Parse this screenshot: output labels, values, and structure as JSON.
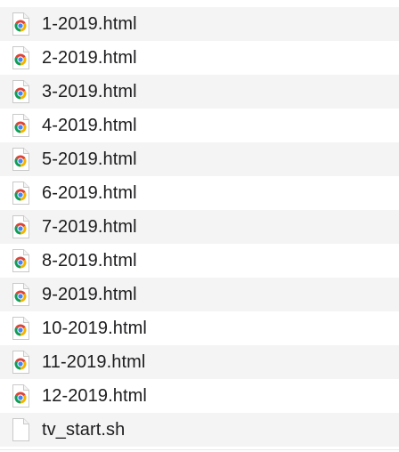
{
  "files": [
    {
      "name": "1-2019.html",
      "icon": "chrome-document-icon"
    },
    {
      "name": "2-2019.html",
      "icon": "chrome-document-icon"
    },
    {
      "name": "3-2019.html",
      "icon": "chrome-document-icon"
    },
    {
      "name": "4-2019.html",
      "icon": "chrome-document-icon"
    },
    {
      "name": "5-2019.html",
      "icon": "chrome-document-icon"
    },
    {
      "name": "6-2019.html",
      "icon": "chrome-document-icon"
    },
    {
      "name": "7-2019.html",
      "icon": "chrome-document-icon"
    },
    {
      "name": "8-2019.html",
      "icon": "chrome-document-icon"
    },
    {
      "name": "9-2019.html",
      "icon": "chrome-document-icon"
    },
    {
      "name": "10-2019.html",
      "icon": "chrome-document-icon"
    },
    {
      "name": "11-2019.html",
      "icon": "chrome-document-icon"
    },
    {
      "name": "12-2019.html",
      "icon": "chrome-document-icon"
    },
    {
      "name": "tv_start.sh",
      "icon": "blank-document-icon"
    }
  ],
  "colors": {
    "stripe": "#f4f4f4",
    "chrome_red": "#db4437",
    "chrome_yellow": "#f4b400",
    "chrome_green": "#0f9d58",
    "chrome_blue": "#4285f4"
  }
}
